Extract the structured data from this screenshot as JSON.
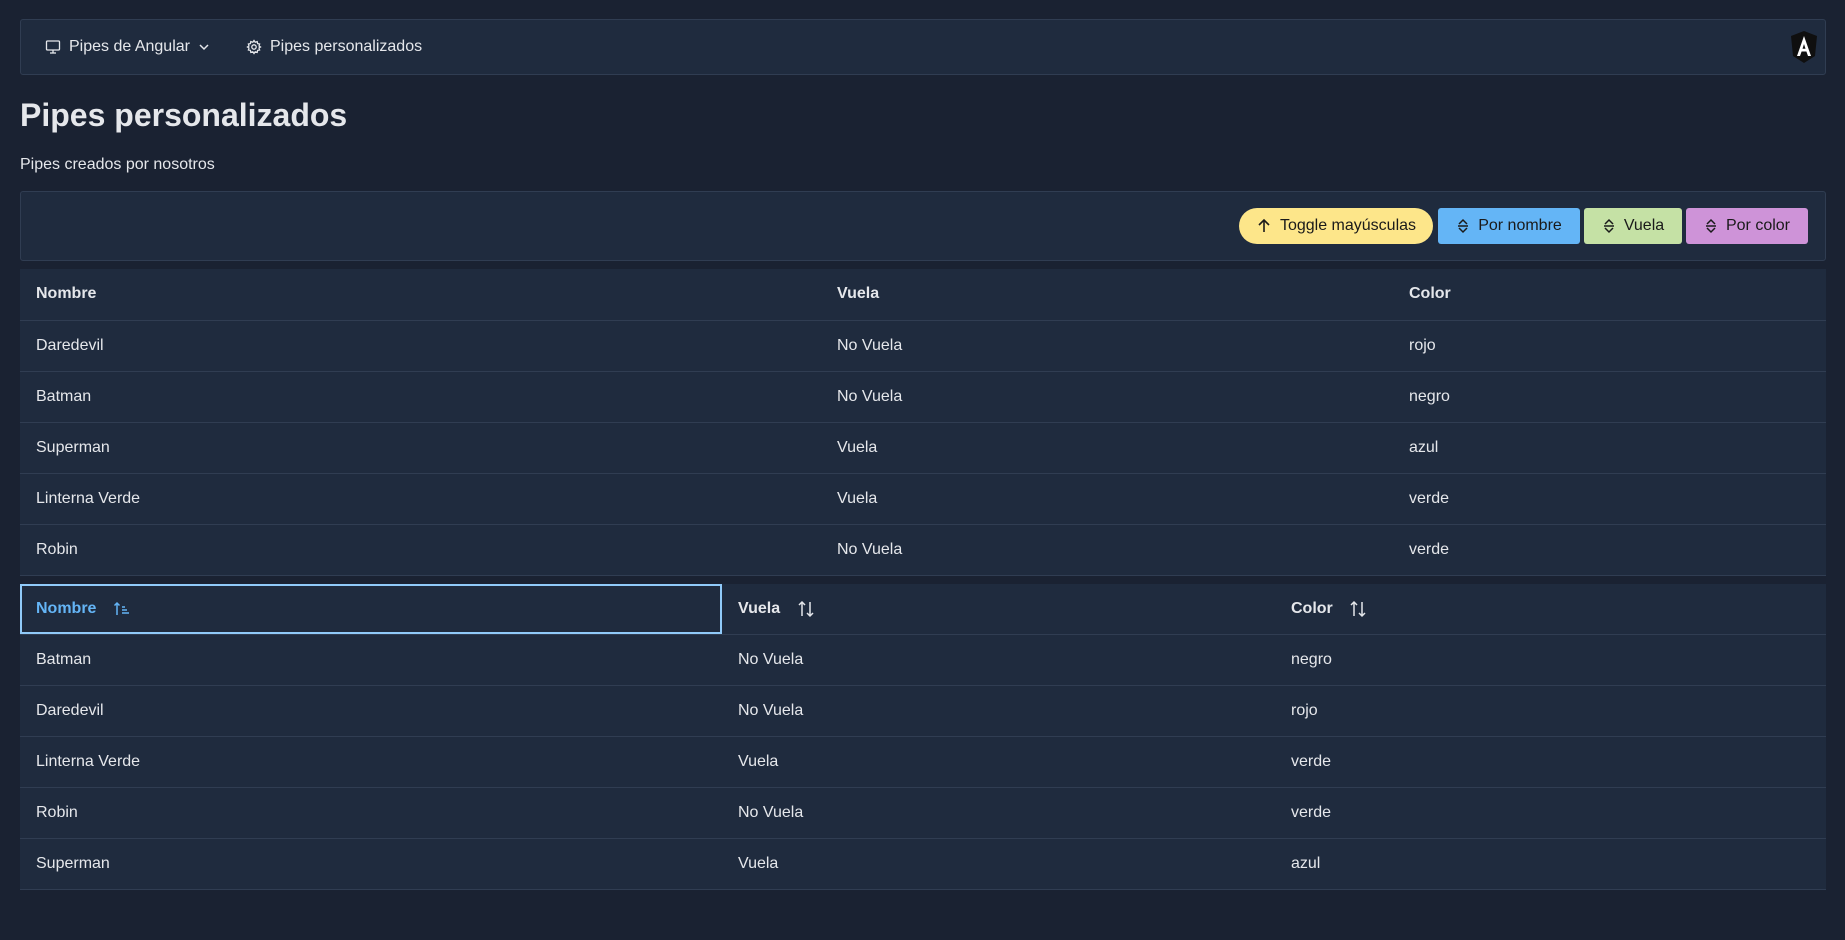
{
  "menubar": {
    "pipes_label": "Pipes de Angular",
    "personal_label": "Pipes personalizados"
  },
  "page": {
    "title": "Pipes personalizados",
    "subtitle": "Pipes creados por nosotros"
  },
  "toolbar": {
    "toggle_label": "Toggle mayúsculas",
    "nombre_label": "Por nombre",
    "vuela_label": "Vuela",
    "color_label": "Por color"
  },
  "colors": {
    "background": "#1a2232",
    "panel": "#1f2b3e",
    "toggle": "#fde68a",
    "nombre": "#64b5f6",
    "vuela": "#c5e1a5",
    "color": "#ce93d8",
    "active_sort": "#64b5f6"
  },
  "table1": {
    "headers": [
      "Nombre",
      "Vuela",
      "Color"
    ],
    "rows": [
      [
        "Daredevil",
        "No Vuela",
        "rojo"
      ],
      [
        "Batman",
        "No Vuela",
        "negro"
      ],
      [
        "Superman",
        "Vuela",
        "azul"
      ],
      [
        "Linterna Verde",
        "Vuela",
        "verde"
      ],
      [
        "Robin",
        "No Vuela",
        "verde"
      ]
    ]
  },
  "table2": {
    "headers": [
      "Nombre",
      "Vuela",
      "Color"
    ],
    "rows": [
      [
        "Batman",
        "No Vuela",
        "negro"
      ],
      [
        "Daredevil",
        "No Vuela",
        "rojo"
      ],
      [
        "Linterna Verde",
        "Vuela",
        "verde"
      ],
      [
        "Robin",
        "No Vuela",
        "verde"
      ],
      [
        "Superman",
        "Vuela",
        "azul"
      ]
    ]
  }
}
